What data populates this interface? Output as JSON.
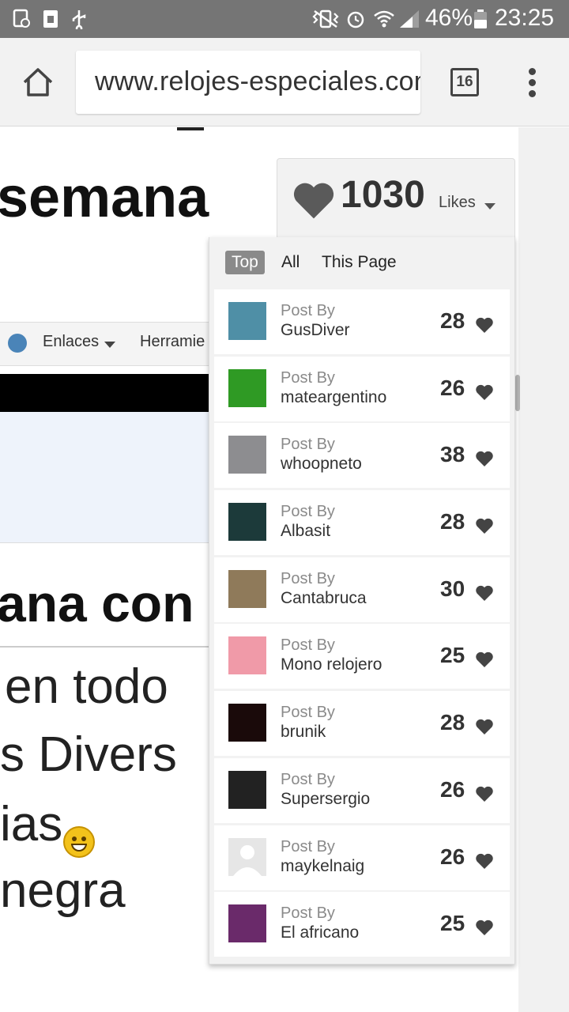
{
  "status_bar": {
    "battery": "46%",
    "time": "23:25",
    "icons": [
      "screenshot-icon",
      "sim-icon",
      "usb-icon",
      "vibrate-icon",
      "alarm-icon",
      "wifi-icon",
      "signal-icon",
      "battery-icon"
    ]
  },
  "browser": {
    "url": "www.relojes-especiales.com",
    "tab_count": "16",
    "icons": [
      "home-icon",
      "tabs-icon",
      "overflow-menu-icon"
    ]
  },
  "page": {
    "headline": "semana",
    "nav_items": [
      "Enlaces",
      "Herramie"
    ],
    "headline2": "ana con t",
    "body_lines": [
      "en todo",
      "s Divers",
      "ias",
      " negra"
    ]
  },
  "likes_widget": {
    "count": "1030",
    "label": "Likes",
    "filters": [
      "Top",
      "All",
      "This Page"
    ],
    "active_filter": "Top",
    "posts": [
      {
        "by_label": "Post By",
        "author": "GusDiver",
        "likes": "28",
        "avatar_color": "#4f8fa6"
      },
      {
        "by_label": "Post By",
        "author": "mateargentino",
        "likes": "26",
        "avatar_color": "#2f9a24"
      },
      {
        "by_label": "Post By",
        "author": "whoopneto",
        "likes": "38",
        "avatar_color": "#8d8d90"
      },
      {
        "by_label": "Post By",
        "author": "Albasit",
        "likes": "28",
        "avatar_color": "#1c3a3a"
      },
      {
        "by_label": "Post By",
        "author": "Cantabruca",
        "likes": "30",
        "avatar_color": "#8f7a5a"
      },
      {
        "by_label": "Post By",
        "author": "Mono relojero",
        "likes": "25",
        "avatar_color": "#f09aa8"
      },
      {
        "by_label": "Post By",
        "author": "brunik",
        "likes": "28",
        "avatar_color": "#1a0a0a"
      },
      {
        "by_label": "Post By",
        "author": "Supersergio",
        "likes": "26",
        "avatar_color": "#222222"
      },
      {
        "by_label": "Post By",
        "author": "maykelnaig",
        "likes": "26",
        "avatar_color": "#e6e6e6"
      },
      {
        "by_label": "Post By",
        "author": "El africano",
        "likes": "25",
        "avatar_color": "#6a2a6a"
      }
    ]
  }
}
